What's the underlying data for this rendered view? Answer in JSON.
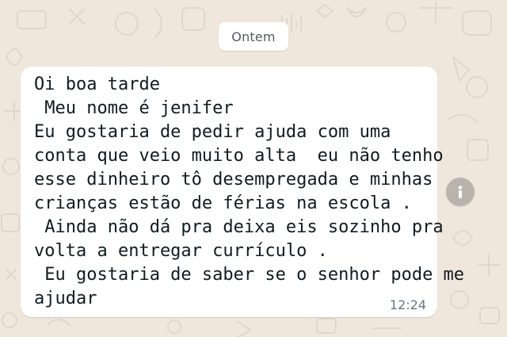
{
  "chat": {
    "date_separator": "Ontem",
    "message": {
      "lines": [
        "Oi boa tarde",
        " Meu nome é jenifer",
        "Eu gostaria de pedir ajuda com uma",
        "conta que veio muito alta  eu não tenho",
        "esse dinheiro tô desempregada e minhas",
        "crianças estão de férias na escola .",
        " Ainda não dá pra deixa eis sozinho pra",
        "volta a entregar currículo .",
        " Eu gostaria de saber se o senhor pode me",
        "ajudar"
      ],
      "time": "12:24"
    },
    "side_action": {
      "icon": "info-icon"
    }
  },
  "colors": {
    "wallpaper": "#efe7dc",
    "bubble": "#ffffff",
    "text": "#111b21",
    "timestamp": "#667781",
    "info_button": "#b8b3ad"
  }
}
